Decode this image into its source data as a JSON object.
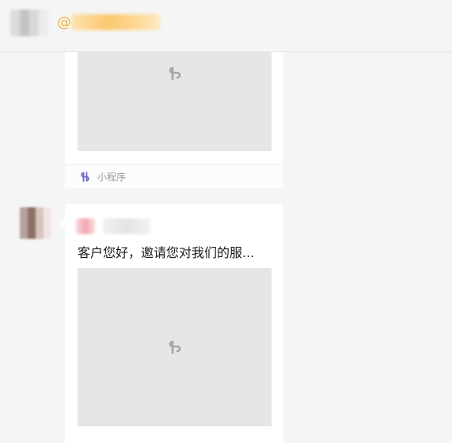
{
  "header": {
    "at_symbol": "@"
  },
  "messages": [
    {
      "type": "mini-program",
      "footer_label": "小程序"
    },
    {
      "type": "mini-program",
      "title": "客户您好，邀请您对我们的服..."
    }
  ],
  "icons": {
    "mini_program": "mini-program-icon",
    "placeholder": "link-icon"
  },
  "colors": {
    "background": "#f5f5f5",
    "card": "#ffffff",
    "thumbnail": "#e6e6e6",
    "mini_program_icon": "#6b67c9",
    "placeholder_icon": "#a6a6a6",
    "mention_accent": "#f0b13a"
  }
}
